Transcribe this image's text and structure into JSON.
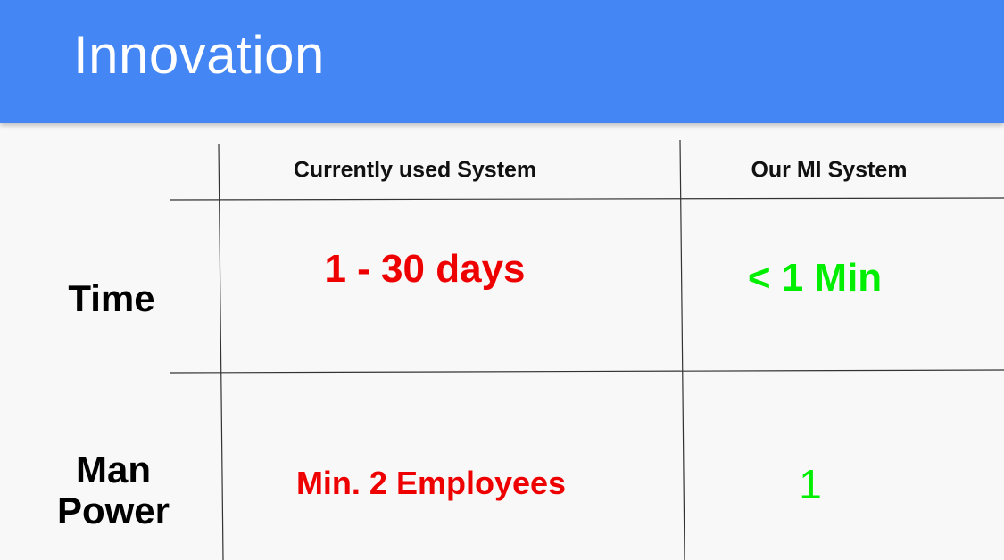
{
  "slide": {
    "title": "Innovation"
  },
  "table": {
    "columns": [
      "Currently used System",
      "Our Ml System"
    ],
    "rows": [
      {
        "label": "Time",
        "cells": [
          "1 - 30 days",
          "< 1 Min"
        ]
      },
      {
        "label": "Man Power",
        "cells": [
          "Min. 2 Employees",
          "1"
        ]
      }
    ],
    "colors": {
      "current_system": "#ee0000",
      "ml_system": "#00ee00",
      "header_bar": "#4486f4"
    }
  }
}
